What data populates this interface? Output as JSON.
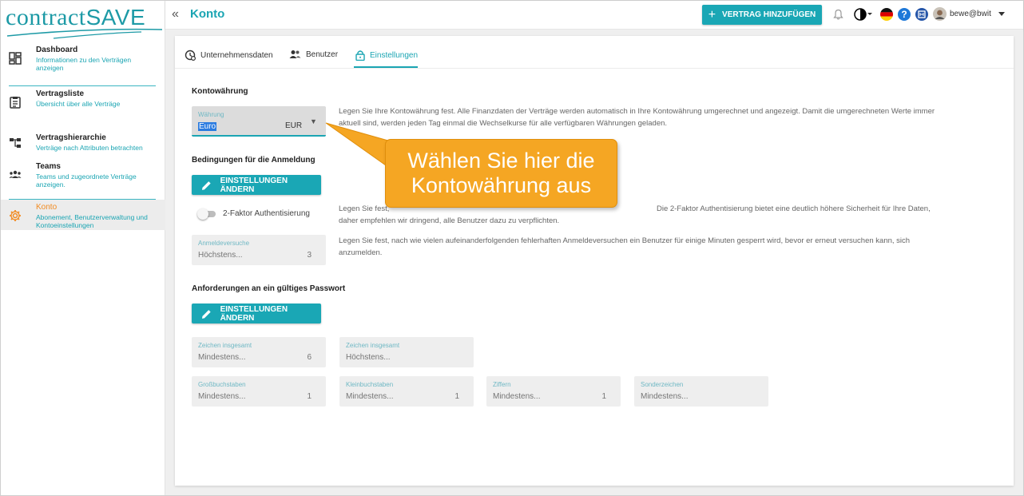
{
  "logo": {
    "brand_left": "contract",
    "brand_right": "SAVE"
  },
  "sidebar": {
    "items": [
      {
        "label": "Dashboard",
        "subtitle": "Informationen zu den Verträgen anzeigen",
        "icon": "dashboard-icon"
      },
      {
        "label": "Vertragsliste",
        "subtitle": "Übersicht über alle Verträge",
        "icon": "list-icon"
      },
      {
        "label": "Vertragshierarchie",
        "subtitle": "Verträge nach Attributen betrachten",
        "icon": "hierarchy-icon"
      },
      {
        "label": "Teams",
        "subtitle": "Teams und zugeordnete Verträge anzeigen.",
        "icon": "teams-icon"
      },
      {
        "label": "Konto",
        "subtitle": "Abonement, Benutzerverwaltung und Kontoeinstellungen",
        "icon": "gear-icon",
        "active": true
      }
    ]
  },
  "header": {
    "collapse_glyph": "«",
    "title": "Konto",
    "add_button": "VERTRAG HINZUFÜGEN",
    "add_glyph": "+",
    "help_glyph": "?",
    "user": "bewe@bwit",
    "icons": [
      "bell-icon",
      "contrast-icon",
      "german-flag-icon",
      "help-icon",
      "app-icon",
      "avatar",
      "caret-down-icon"
    ]
  },
  "tabs": [
    {
      "label": "Unternehmensdaten",
      "icon": "company-icon"
    },
    {
      "label": "Benutzer",
      "icon": "users-icon"
    },
    {
      "label": "Einstellungen",
      "icon": "lock-icon",
      "active": true
    }
  ],
  "currency": {
    "section_title": "Kontowährung",
    "field_label": "Währung",
    "value": "Euro",
    "code": "EUR",
    "arrow_glyph": "▼",
    "description": "Legen Sie Ihre Kontowährung fest. Alle Finanzdaten der Verträge werden automatisch in Ihre Kontowährung umgerechnet und angezeigt. Damit die umgerechneten Werte immer aktuell sind, werden jeden Tag einmal die Wechselkurse für alle verfügbaren Währungen geladen."
  },
  "login": {
    "section_title": "Bedingungen für die Anmeldung",
    "button": "EINSTELLUNGEN ÄNDERN",
    "toggle_label": "2-Faktor Authentisierung",
    "toggle_on": false,
    "twofa_description_start": "Legen Sie fest,",
    "twofa_description_end": "Die 2-Faktor Authentisierung bietet eine deutlich höhere Sicherheit für Ihre Daten, daher empfehlen wir dringend, alle Benutzer dazu zu verpflichten.",
    "attempts": {
      "label": "Anmeldeversuche",
      "placeholder": "Höchstens...",
      "value": "3"
    },
    "attempts_description": "Legen Sie fest, nach wie vielen aufeinanderfolgenden fehlerhaften Anmeldeversuchen ein Benutzer für einige Minuten gesperrt wird, bevor er erneut versuchen kann, sich anzumelden."
  },
  "password": {
    "section_title": "Anforderungen an ein gültiges Passwort",
    "button": "EINSTELLUNGEN ÄNDERN",
    "fields": [
      {
        "label": "Zeichen insgesamt",
        "placeholder": "Mindestens...",
        "value": "6"
      },
      {
        "label": "Zeichen insgesamt",
        "placeholder": "Höchstens...",
        "value": ""
      },
      {
        "label": "Großbuchstaben",
        "placeholder": "Mindestens...",
        "value": "1"
      },
      {
        "label": "Kleinbuchstaben",
        "placeholder": "Mindestens...",
        "value": "1"
      },
      {
        "label": "Ziffern",
        "placeholder": "Mindestens...",
        "value": "1"
      },
      {
        "label": "Sonderzeichen",
        "placeholder": "Mindestens...",
        "value": ""
      }
    ]
  },
  "callout": {
    "text": "Wählen Sie hier die Kontowährung aus"
  },
  "colors": {
    "accent": "#1aa7b5",
    "active_nav": "#f28b22",
    "callout": "#f5a623"
  }
}
